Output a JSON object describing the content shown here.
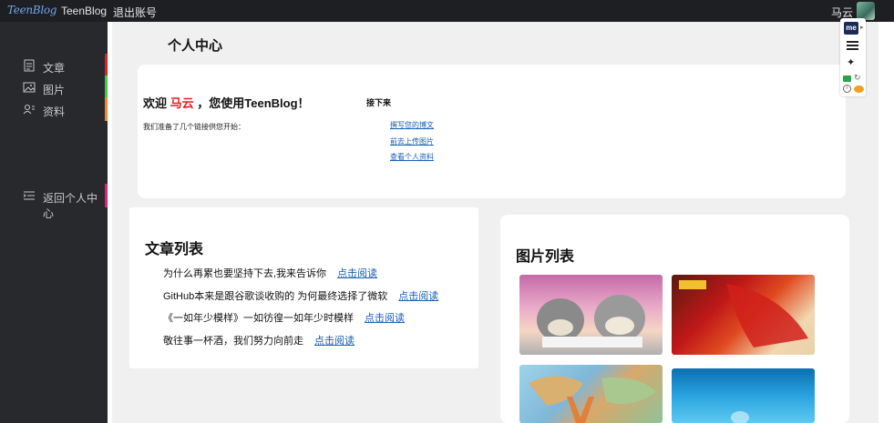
{
  "topbar": {
    "logo": "TeenBlog",
    "brand": "TeenBlog",
    "logout": "退出账号",
    "username": "马云"
  },
  "sidebar": {
    "items": [
      {
        "label": "文章",
        "icon": "document-icon",
        "color": "#e02020"
      },
      {
        "label": "图片",
        "icon": "image-icon",
        "color": "#3ad23a"
      },
      {
        "label": "资料",
        "icon": "profile-card-icon",
        "color": "#f08a2a"
      },
      {
        "label": "返回个人中心",
        "icon": "list-indent-icon",
        "color": "#e0207a"
      }
    ]
  },
  "page": {
    "title": "个人中心"
  },
  "welcome": {
    "prefix": "欢迎 ",
    "name": "马云",
    "suffix": " ，您使用TeenBlog！",
    "prepared": "我们准备了几个链接供您开始：",
    "next_title": "接下来",
    "links": [
      "撰写您的博文",
      "前去上传图片",
      "查看个人资料"
    ]
  },
  "articles": {
    "title": "文章列表",
    "read_label": "点击阅读",
    "items": [
      "为什么再累也要坚持下去,我来告诉你",
      "GitHub本来是跟谷歌谈收购的 为何最终选择了微软",
      "《一如年少模样》一如彷徨一如年少时模样",
      "敬往事一杯酒，我们努力向前走"
    ]
  },
  "images": {
    "title": "图片列表"
  },
  "float_bar": {
    "me_label": "me"
  }
}
